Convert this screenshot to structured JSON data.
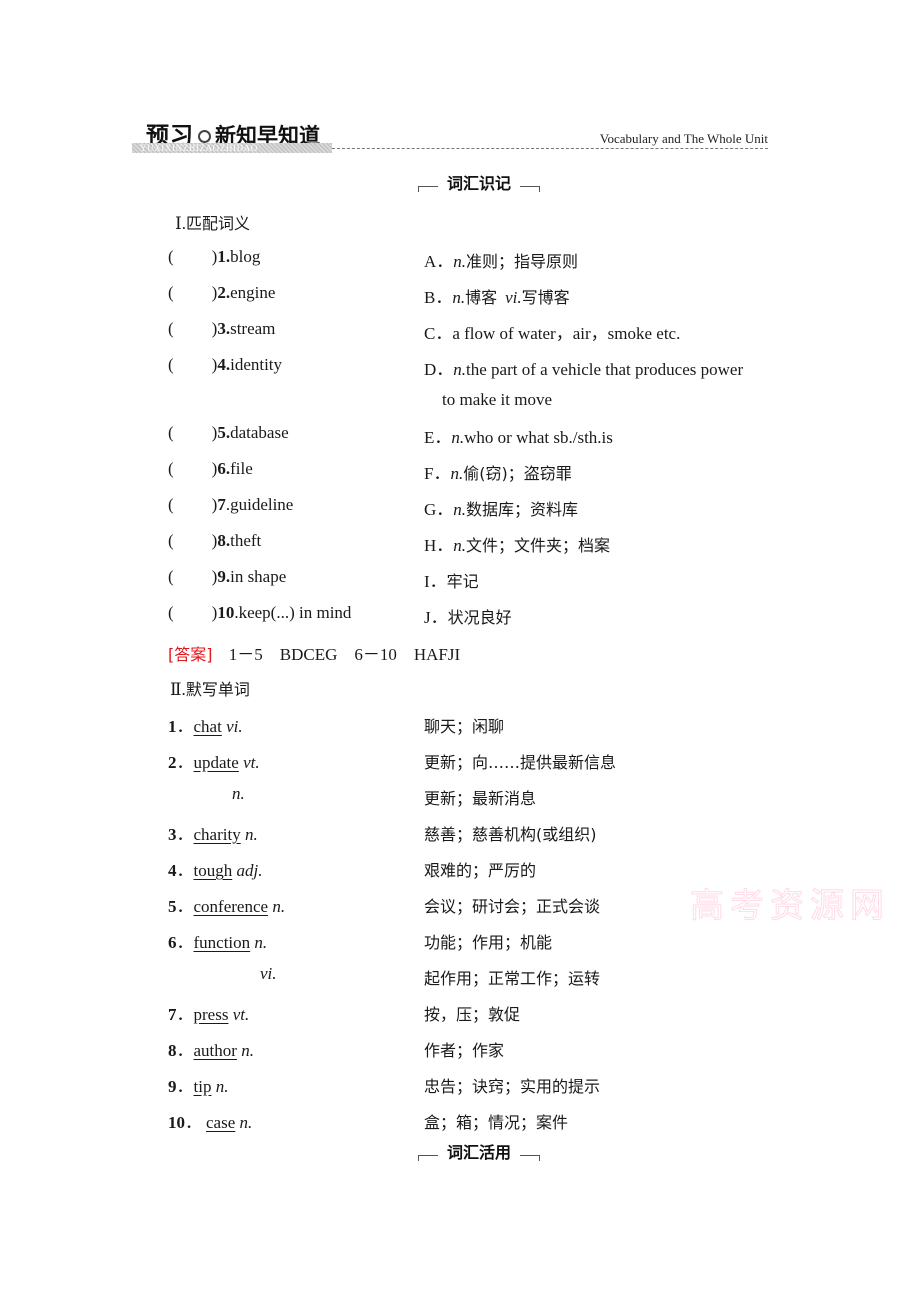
{
  "header": {
    "title_prefix": "预习",
    "title_main": "新知早知道",
    "pinyin": "YUXIXINZHIZAOZHIDAO",
    "unit": "Vocabulary and The Whole Unit"
  },
  "badges": {
    "vocab_memory": "词汇识记",
    "vocab_usage": "词汇活用"
  },
  "part1": {
    "heading_num": "Ⅰ.",
    "heading": "匹配词义",
    "paren_open": "(",
    "paren_close": ")",
    "items": [
      {
        "num": "1.",
        "word": "blog",
        "bold_dot": true
      },
      {
        "num": "2.",
        "word": "engine",
        "bold_dot": true
      },
      {
        "num": "3.",
        "word": "stream",
        "bold_dot": true
      },
      {
        "num": "4.",
        "word": "identity",
        "bold_dot": true
      },
      {
        "num": "5.",
        "word": "database",
        "bold_dot": true
      },
      {
        "num": "6.",
        "word": "file",
        "bold_dot": true
      },
      {
        "num": "7",
        "word": ".guideline",
        "bold_dot": false
      },
      {
        "num": "8.",
        "word": "theft",
        "bold_dot": true
      },
      {
        "num": "9.",
        "word": "in shape",
        "bold_dot": true
      },
      {
        "num": "10",
        "word": ".keep(...) in mind",
        "bold_dot": false
      }
    ],
    "options": [
      {
        "letter": "A．",
        "pos": "n.",
        "text": "准则；指导原则"
      },
      {
        "letter": "B．",
        "pos": "n.",
        "text": "博客",
        "pos2": "vi.",
        "text2": "写博客"
      },
      {
        "letter": "C．",
        "pos": "",
        "text": "a flow of water，air，smoke etc."
      },
      {
        "letter": "D．",
        "pos": "n.",
        "text": "the part of a vehicle that produces power",
        "continuation": "to make it move"
      },
      {
        "letter": "E．",
        "pos": "n.",
        "text": "who or what sb./sth.is"
      },
      {
        "letter": "F．",
        "pos": "n.",
        "text": "偷(窃)；盗窃罪"
      },
      {
        "letter": "G．",
        "pos": "n.",
        "text": "数据库；资料库"
      },
      {
        "letter": "H．",
        "pos": "n.",
        "text": "文件；文件夹；档案"
      },
      {
        "letter": "I．",
        "pos": "",
        "text": "牢记"
      },
      {
        "letter": "J．",
        "pos": "",
        "text": "状况良好"
      }
    ],
    "answer_label": "[答案]",
    "answer_text": "1－5　BDCEG　6－10　HAFJI"
  },
  "part2": {
    "heading_num": "Ⅱ.",
    "heading": "默写单词",
    "items": [
      {
        "num": "1",
        "word": "chat",
        "pos": "vi.",
        "meaning": "聊天；闲聊"
      },
      {
        "num": "2",
        "word": "update",
        "pos": "vt.",
        "meaning": "更新；向……提供最新信息"
      },
      {
        "num": "",
        "word": "",
        "pos": "n.",
        "meaning": "更新；最新消息"
      },
      {
        "num": "3",
        "word": "charity",
        "pos": "n.",
        "meaning": "慈善；慈善机构(或组织)"
      },
      {
        "num": "4",
        "word": "tough",
        "pos": "adj.",
        "meaning": "艰难的；严厉的"
      },
      {
        "num": "5",
        "word": "conference",
        "pos": "n.",
        "meaning": "会议；研讨会；正式会谈"
      },
      {
        "num": "6",
        "word": "function",
        "pos": "n.",
        "meaning": "功能；作用；机能"
      },
      {
        "num": "",
        "word": "",
        "pos": "vi.",
        "meaning": "起作用；正常工作；运转"
      },
      {
        "num": "7",
        "word": "press",
        "pos": "vt.",
        "meaning": "按，压；敦促"
      },
      {
        "num": "8",
        "word": "author",
        "pos": "n.",
        "meaning": "作者；作家"
      },
      {
        "num": "9",
        "word": "tip",
        "pos": "n.",
        "meaning": "忠告；诀窍；实用的提示"
      },
      {
        "num": "10",
        "word": "case",
        "pos": "n.",
        "meaning": "盒；箱；情况；案件"
      }
    ],
    "num_sep": "．"
  },
  "watermark": "高考资源网",
  "colors": {
    "answer_red": "#e0161b",
    "text": "#1a1a1a"
  }
}
